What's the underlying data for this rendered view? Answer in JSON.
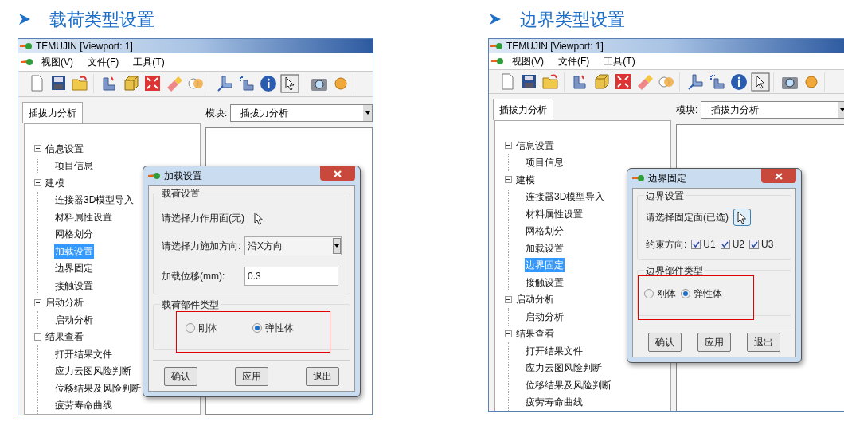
{
  "panels": [
    {
      "heading": "载荷类型设置",
      "window": {
        "title": "TEMUJIN [Viewport: 1]",
        "menu": [
          "视图(V)",
          "文件(F)",
          "工具(T)"
        ],
        "tab": "插拔力分析",
        "module_label": "模块:",
        "module_value": "插拔力分析",
        "tree": [
          {
            "label": "信息设置",
            "expanded": true,
            "children": [
              {
                "label": "项目信息",
                "selected": false
              }
            ]
          },
          {
            "label": "建模",
            "expanded": true,
            "children": [
              {
                "label": "连接器3D模型导入",
                "selected": false
              },
              {
                "label": "材料属性设置",
                "selected": false
              },
              {
                "label": "网格划分",
                "selected": false
              },
              {
                "label": "加载设置",
                "selected": true
              },
              {
                "label": "边界固定",
                "selected": false
              },
              {
                "label": "接触设置",
                "selected": false
              }
            ]
          },
          {
            "label": "启动分析",
            "expanded": true,
            "children": [
              {
                "label": "启动分析",
                "selected": false
              }
            ]
          },
          {
            "label": "结果查看",
            "expanded": true,
            "children": [
              {
                "label": "打开结果文件",
                "selected": false
              },
              {
                "label": "应力云图风险判断",
                "selected": false
              },
              {
                "label": "位移结果及风险判断",
                "selected": false
              },
              {
                "label": "疲劳寿命曲线",
                "selected": false
              }
            ]
          }
        ]
      },
      "dialog": {
        "title": "加载设置",
        "group": "载荷设置",
        "rows": [
          {
            "kind": "cursor",
            "label": "请选择力作用面(无)"
          },
          {
            "kind": "select",
            "label": "请选择力施加方向:",
            "value": "沿X方向"
          },
          {
            "kind": "input",
            "label": "加载位移(mm):",
            "value": "0.3"
          }
        ],
        "type_group": "载荷部件类型",
        "options": [
          {
            "label": "刚体",
            "selected": false
          },
          {
            "label": "弹性体",
            "selected": true
          }
        ],
        "buttons": [
          "确认",
          "应用",
          "退出"
        ]
      }
    },
    {
      "heading": "边界类型设置",
      "window": {
        "title": "TEMUJIN [Viewport: 1]",
        "menu": [
          "视图(V)",
          "文件(F)",
          "工具(T)"
        ],
        "tab": "插拔力分析",
        "module_label": "模块:",
        "module_value": "插拔力分析",
        "tree": [
          {
            "label": "信息设置",
            "expanded": true,
            "children": [
              {
                "label": "项目信息",
                "selected": false
              }
            ]
          },
          {
            "label": "建模",
            "expanded": true,
            "children": [
              {
                "label": "连接器3D模型导入",
                "selected": false
              },
              {
                "label": "材料属性设置",
                "selected": false
              },
              {
                "label": "网格划分",
                "selected": false
              },
              {
                "label": "加载设置",
                "selected": false
              },
              {
                "label": "边界固定",
                "selected": true
              },
              {
                "label": "接触设置",
                "selected": false
              }
            ]
          },
          {
            "label": "启动分析",
            "expanded": true,
            "children": [
              {
                "label": "启动分析",
                "selected": false
              }
            ]
          },
          {
            "label": "结果查看",
            "expanded": true,
            "children": [
              {
                "label": "打开结果文件",
                "selected": false
              },
              {
                "label": "应力云图风险判断",
                "selected": false
              },
              {
                "label": "位移结果及风险判断",
                "selected": false
              },
              {
                "label": "疲劳寿命曲线",
                "selected": false
              }
            ]
          }
        ]
      },
      "dialog": {
        "title": "边界固定",
        "group": "边界设置",
        "rows": [
          {
            "kind": "pick",
            "label": "请选择固定面(已选)"
          },
          {
            "kind": "checks",
            "label": "约束方向:",
            "items": [
              {
                "label": "U1",
                "checked": true
              },
              {
                "label": "U2",
                "checked": true
              },
              {
                "label": "U3",
                "checked": true
              }
            ]
          }
        ],
        "type_group": "边界部件类型",
        "options": [
          {
            "label": "刚体",
            "selected": false
          },
          {
            "label": "弹性体",
            "selected": true
          }
        ],
        "buttons": [
          "确认",
          "应用",
          "退出"
        ]
      }
    }
  ]
}
